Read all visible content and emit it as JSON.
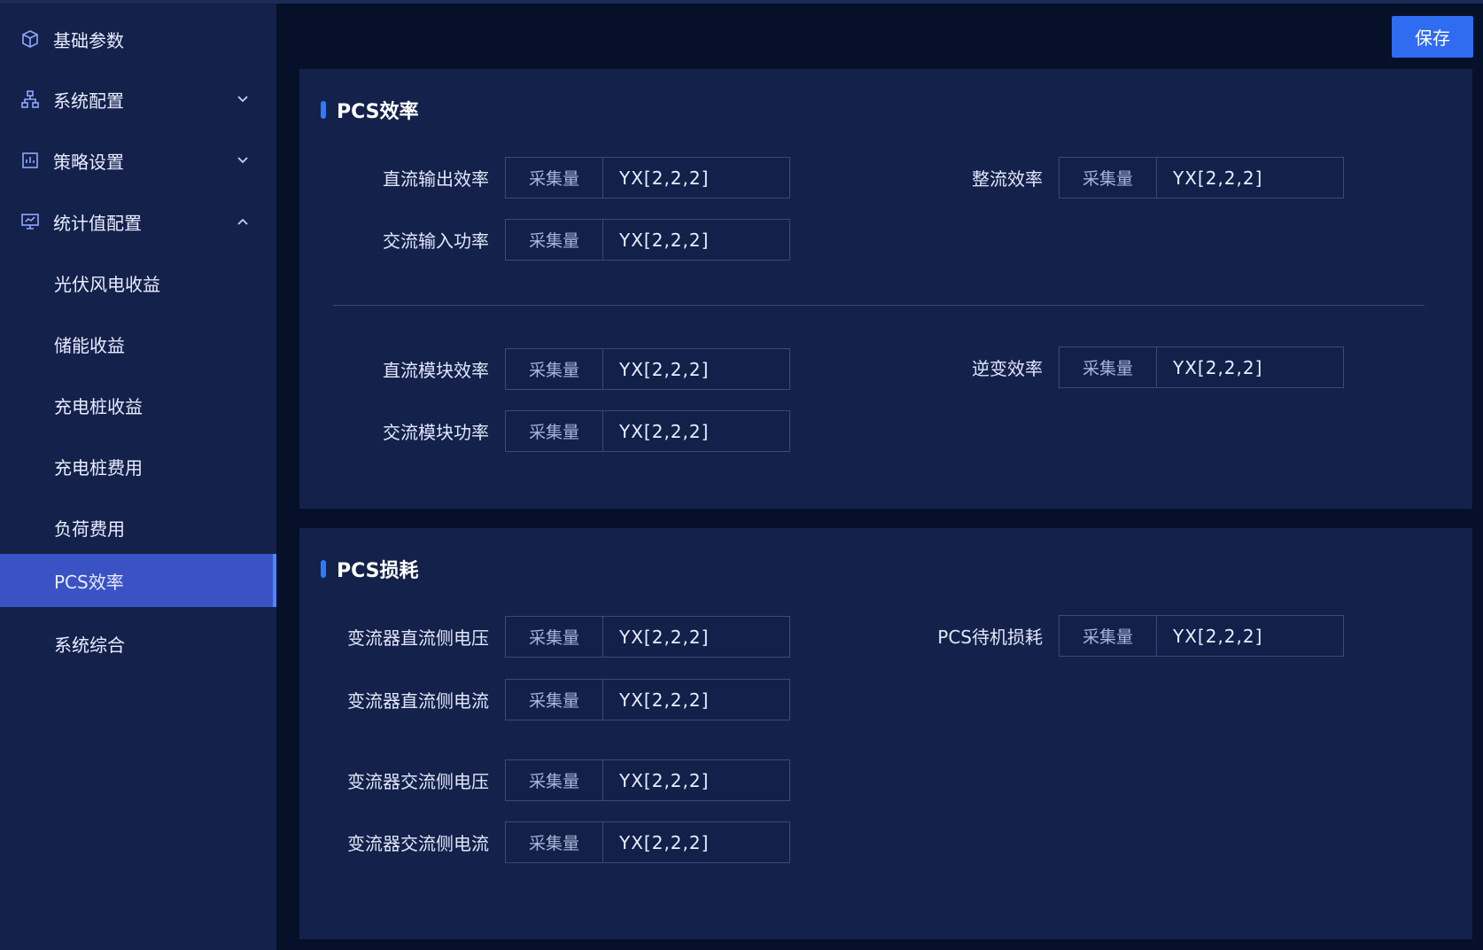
{
  "sidebar": {
    "items": [
      {
        "label": "基础参数",
        "icon": "cube-icon",
        "expandable": false
      },
      {
        "label": "系统配置",
        "icon": "hierarchy-icon",
        "expandable": true,
        "expanded": false
      },
      {
        "label": "策略设置",
        "icon": "strategy-icon",
        "expandable": true,
        "expanded": false
      },
      {
        "label": "统计值配置",
        "icon": "monitor-icon",
        "expandable": true,
        "expanded": true
      }
    ],
    "subitems": [
      {
        "label": "光伏风电收益",
        "active": false
      },
      {
        "label": "储能收益",
        "active": false
      },
      {
        "label": "充电桩收益",
        "active": false
      },
      {
        "label": "充电桩费用",
        "active": false
      },
      {
        "label": "负荷费用",
        "active": false
      },
      {
        "label": "PCS效率",
        "active": true
      },
      {
        "label": "系统综合",
        "active": false
      }
    ]
  },
  "toolbar": {
    "save_label": "保存"
  },
  "colors": {
    "accent": "#2f6cf2",
    "active_menu": "#3b52c4",
    "panel": "#14214a",
    "background": "#061028"
  },
  "panels": [
    {
      "title": "PCS效率",
      "fields": [
        {
          "label": "直流输出效率",
          "addon": "采集量",
          "value": "YX[2,2,2]"
        },
        {
          "label": "整流效率",
          "addon": "采集量",
          "value": "YX[2,2,2]"
        },
        {
          "label": "交流输入功率",
          "addon": "采集量",
          "value": "YX[2,2,2]"
        },
        {
          "label": "直流模块效率",
          "addon": "采集量",
          "value": "YX[2,2,2]"
        },
        {
          "label": "逆变效率",
          "addon": "采集量",
          "value": "YX[2,2,2]"
        },
        {
          "label": "交流模块功率",
          "addon": "采集量",
          "value": "YX[2,2,2]"
        }
      ]
    },
    {
      "title": "PCS损耗",
      "fields": [
        {
          "label": "变流器直流侧电压",
          "addon": "采集量",
          "value": "YX[2,2,2]"
        },
        {
          "label": "PCS待机损耗",
          "addon": "采集量",
          "value": "YX[2,2,2]"
        },
        {
          "label": "变流器直流侧电流",
          "addon": "采集量",
          "value": "YX[2,2,2]"
        },
        {
          "label": "变流器交流侧电压",
          "addon": "采集量",
          "value": "YX[2,2,2]"
        },
        {
          "label": "变流器交流侧电流",
          "addon": "采集量",
          "value": "YX[2,2,2]"
        }
      ]
    }
  ]
}
